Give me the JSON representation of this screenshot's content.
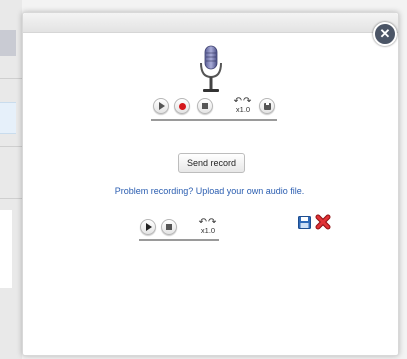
{
  "recorder": {
    "speed_label": "x1.0"
  },
  "upload_player": {
    "speed_label": "x1.0"
  },
  "send_button": "Send record",
  "upload_link": "Problem recording? Upload your own audio file.",
  "icons": {
    "close": "close-icon",
    "microphone": "microphone-icon",
    "save": "floppy-disk-icon",
    "delete": "red-x-icon"
  },
  "colors": {
    "record_dot": "#d4161b",
    "link": "#2a5db0",
    "close_button": "#4b5566"
  }
}
